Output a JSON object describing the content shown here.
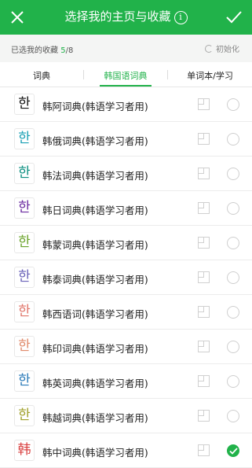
{
  "header": {
    "title": "选择我的主页与收藏",
    "info_glyph": "i",
    "bg_color": "#21b24a"
  },
  "subbar": {
    "selected_label": "已选我的收藏",
    "selected_count": "5",
    "total_count": "8",
    "reset_label": "初始化"
  },
  "tabs": [
    {
      "label": "词典"
    },
    {
      "label": "韩国语词典",
      "active": true
    },
    {
      "label": "单词本/学习"
    }
  ],
  "rows": [
    {
      "glyph": "한",
      "glyph_color": "#111111",
      "label": "韩阿词典(韩语学习者用)",
      "checked": false
    },
    {
      "glyph": "한",
      "glyph_color": "#1aa0b4",
      "label": "韩俄词典(韩语学习者用)",
      "checked": false
    },
    {
      "glyph": "한",
      "glyph_color": "#0b8f80",
      "label": "韩法词典(韩语学习者用)",
      "checked": false
    },
    {
      "glyph": "한",
      "glyph_color": "#6a2aa0",
      "label": "韩日词典(韩语学习者用)",
      "checked": false
    },
    {
      "glyph": "한",
      "glyph_color": "#6aa32a",
      "label": "韩蒙词典(韩语学习者用)",
      "checked": false
    },
    {
      "glyph": "한",
      "glyph_color": "#6a62b8",
      "label": "韩泰词典(韩语学习者用)",
      "checked": false
    },
    {
      "glyph": "한",
      "glyph_color": "#e0756a",
      "label": "韩西语词(韩语学习者用)",
      "checked": false
    },
    {
      "glyph": "한",
      "glyph_color": "#e08a6a",
      "label": "韩印词典(韩语学习者用)",
      "checked": false
    },
    {
      "glyph": "한",
      "glyph_color": "#2a7ab8",
      "label": "韩英词典(韩语学习者用)",
      "checked": false
    },
    {
      "glyph": "한",
      "glyph_color": "#a0a02a",
      "label": "韩越词典(韩语学习者用)",
      "checked": false
    },
    {
      "glyph": "韩",
      "glyph_color": "#d94040",
      "label": "韩中词典(韩语学习者用)",
      "checked": true
    }
  ]
}
